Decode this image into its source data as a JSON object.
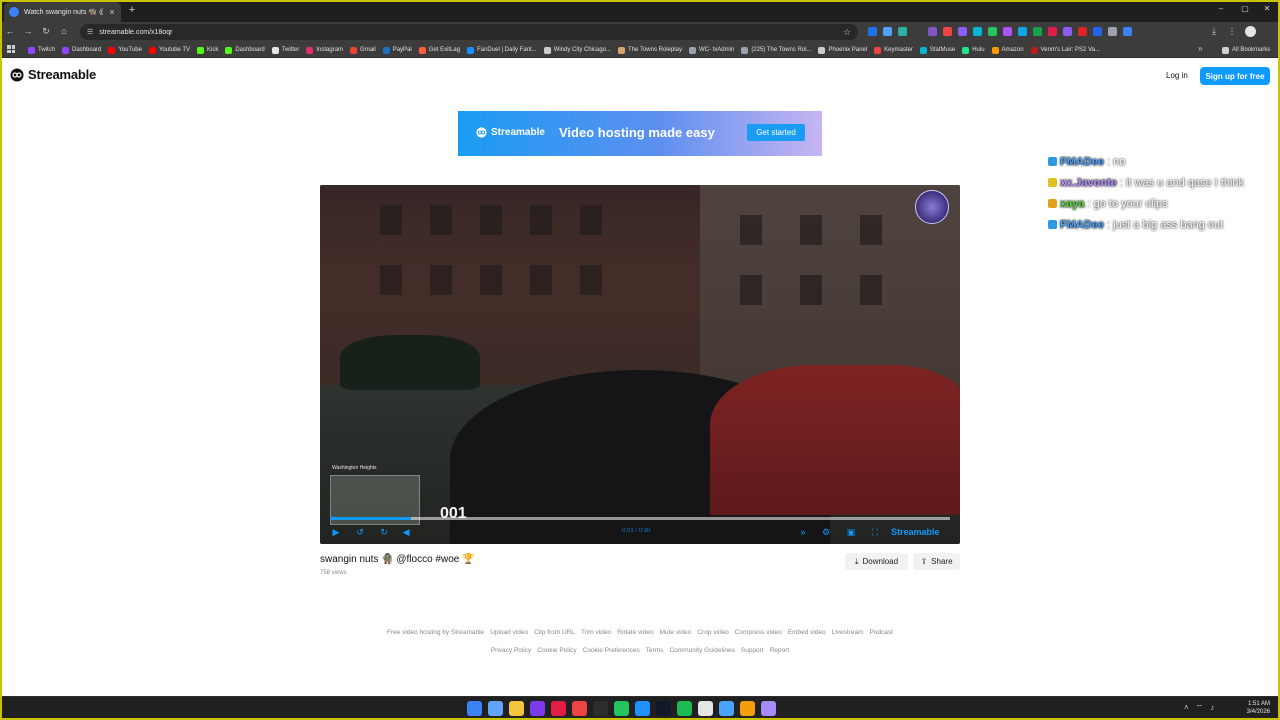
{
  "browser": {
    "tab_title": "Watch swangin nuts 🧌 @flocc",
    "tab_close": "×",
    "new_tab": "+",
    "url": "streamable.com/x18oqr",
    "window_controls": {
      "minimize": "–",
      "maximize": "▢",
      "close": "✕"
    },
    "extension_colors": [
      "#1a73e8",
      "#4fa3ff",
      "#2bb3a3",
      "#3a3a3a",
      "#7e57c2",
      "#ef4444",
      "#8b5cf6",
      "#06b6d4",
      "#22c55e",
      "#a855f7",
      "#0ea5e9",
      "#16a34a",
      "#e11d48",
      "#8b5cf6",
      "#dc2626",
      "#2563eb",
      "#9ca3af",
      "#3b82f6"
    ],
    "bookmarks": [
      {
        "label": "Twitch",
        "color": "#9146ff"
      },
      {
        "label": "Dashboard",
        "color": "#9146ff"
      },
      {
        "label": "YouTube",
        "color": "#ff0000"
      },
      {
        "label": "Youtube TV",
        "color": "#ff0000"
      },
      {
        "label": "Kick",
        "color": "#53fc18"
      },
      {
        "label": "Dashboard",
        "color": "#53fc18"
      },
      {
        "label": "Twitter",
        "color": "#e5e5e5"
      },
      {
        "label": "Instagram",
        "color": "#e1306c"
      },
      {
        "label": "Gmail",
        "color": "#ea4335"
      },
      {
        "label": "PayPal",
        "color": "#1f70c1"
      },
      {
        "label": "Get ExitLag",
        "color": "#ff5e3a"
      },
      {
        "label": "FanDuel | Daily Fant...",
        "color": "#1493ff"
      },
      {
        "label": "Windy City Chicago...",
        "color": "#cccccc"
      },
      {
        "label": "The Towns Roleplay",
        "color": "#d4a373"
      },
      {
        "label": "WC- txAdmin",
        "color": "#9ca3af"
      },
      {
        "label": "(225) The Towns Rol...",
        "color": "#9ca3af"
      },
      {
        "label": "Phoenix Panel",
        "color": "#cccccc"
      },
      {
        "label": "Keymaster",
        "color": "#ef4444"
      },
      {
        "label": "StatMuse",
        "color": "#06b6d4"
      },
      {
        "label": "Hulu",
        "color": "#1ce783"
      },
      {
        "label": "Amazon",
        "color": "#ff9900"
      },
      {
        "label": "Venm's Lair: PS2 Va...",
        "color": "#b91c1c"
      }
    ],
    "bookmarks_more": "»",
    "all_bookmarks": "All Bookmarks"
  },
  "site": {
    "logo_text": "Streamable",
    "login": "Log in",
    "signup": "Sign up for free"
  },
  "ad": {
    "logo_text": "Streamable",
    "tagline": "Video hosting made easy",
    "cta": "Get started"
  },
  "video": {
    "location": "Washington Heights",
    "speed": "001",
    "time": "0:01 / 0:30",
    "brand": "Streamable",
    "progress_fraction": 0.13,
    "title": "swangin nuts 🧌 @flocco #woe 🏆",
    "views": "758 views",
    "download": "Download",
    "share": "Share"
  },
  "chat": [
    {
      "user": "FMADee",
      "user_color": "#4aa3ff",
      "msg": ": no",
      "badge_color": "#2b9be0"
    },
    {
      "user": "xx.Javonte",
      "user_color": "#b690ff",
      "msg": ": it was u and qase I think",
      "badge_color": "#e0c020"
    },
    {
      "user": "xaya",
      "user_color": "#5cdb3a",
      "msg": ": go to your clips",
      "badge_color": "#e6a020"
    },
    {
      "user": "FMADee",
      "user_color": "#4aa3ff",
      "msg": ": just a big ass bang out",
      "badge_color": "#2b9be0"
    }
  ],
  "footer": {
    "row1": [
      "Free video hosting by Streamable",
      "Upload video",
      "Clip from URL",
      "Trim video",
      "Rotate video",
      "Mute video",
      "Crop video",
      "Compress video",
      "Embed video",
      "Livestream",
      "Podcast"
    ],
    "row2": [
      "Privacy Policy",
      "Cookie Policy",
      "Cookie Preferences",
      "Terms",
      "Community Guidelines",
      "Support",
      "Report"
    ]
  },
  "taskbar": {
    "app_colors": [
      "#3b82f6",
      "#60a5fa",
      "#f5c542",
      "#7c3aed",
      "#e11d48",
      "#ef4444",
      "#2d2d2d",
      "#22c55e",
      "#1e90ff",
      "#111827",
      "#1db954",
      "#e5e5e5",
      "#4aa3ff",
      "#f59e0b",
      "#a78bfa"
    ],
    "time": "1:51 AM",
    "date": "3/4/2026"
  }
}
